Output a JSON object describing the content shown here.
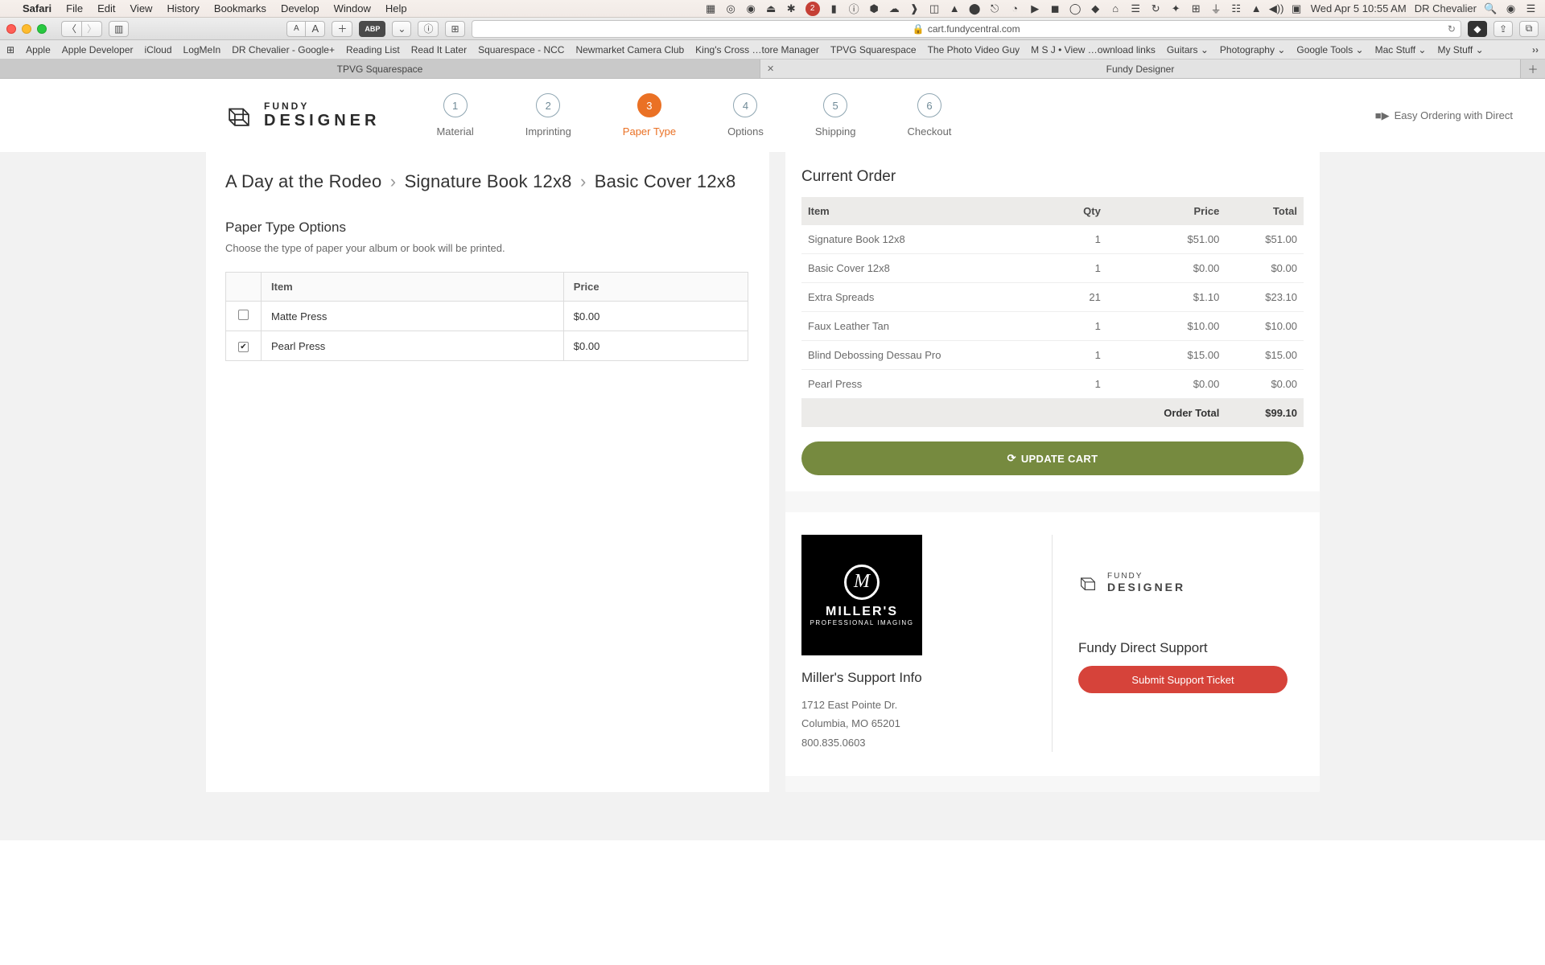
{
  "menubar": {
    "app": "Safari",
    "items": [
      "File",
      "Edit",
      "View",
      "History",
      "Bookmarks",
      "Develop",
      "Window",
      "Help"
    ],
    "clock": "Wed Apr 5  10:55 AM",
    "user": "DR Chevalier",
    "badge": "2"
  },
  "safari": {
    "url": "cart.fundycentral.com",
    "bookmarks": [
      "Apple",
      "Apple Developer",
      "iCloud",
      "LogMeIn",
      "DR Chevalier - Google+",
      "Reading List",
      "Read It Later",
      "Squarespace - NCC",
      "Newmarket Camera Club",
      "King's Cross …tore Manager",
      "TPVG Squarespace",
      "The Photo Video Guy",
      "M S J • View …ownload links",
      "Guitars",
      "Photography",
      "Google Tools",
      "Mac Stuff",
      "My Stuff"
    ],
    "tabs": [
      {
        "label": "TPVG Squarespace",
        "active": false
      },
      {
        "label": "Fundy Designer",
        "active": true
      }
    ]
  },
  "logo": {
    "line1": "FUNDY",
    "line2": "DESIGNER"
  },
  "steps": [
    {
      "n": "1",
      "label": "Material"
    },
    {
      "n": "2",
      "label": "Imprinting"
    },
    {
      "n": "3",
      "label": "Paper Type"
    },
    {
      "n": "4",
      "label": "Options"
    },
    {
      "n": "5",
      "label": "Shipping"
    },
    {
      "n": "6",
      "label": "Checkout"
    }
  ],
  "active_step": 2,
  "easy_ordering": "Easy Ordering with Direct",
  "breadcrumb": [
    "A Day at the Rodeo",
    "Signature Book 12x8",
    "Basic Cover 12x8"
  ],
  "section": {
    "title": "Paper Type Options",
    "desc": "Choose the type of paper your album or book will be printed."
  },
  "opt_headers": [
    "Item",
    "Price"
  ],
  "options": [
    {
      "selected": false,
      "item": "Matte Press",
      "price": "$0.00"
    },
    {
      "selected": true,
      "item": "Pearl Press",
      "price": "$0.00"
    }
  ],
  "order": {
    "title": "Current Order",
    "headers": [
      "Item",
      "Qty",
      "Price",
      "Total"
    ],
    "rows": [
      {
        "item": "Signature Book 12x8",
        "qty": "1",
        "price": "$51.00",
        "total": "$51.00"
      },
      {
        "item": "Basic Cover 12x8",
        "qty": "1",
        "price": "$0.00",
        "total": "$0.00"
      },
      {
        "item": "Extra Spreads",
        "qty": "21",
        "price": "$1.10",
        "total": "$23.10"
      },
      {
        "item": "Faux Leather Tan",
        "qty": "1",
        "price": "$10.00",
        "total": "$10.00"
      },
      {
        "item": "Blind Debossing Dessau Pro",
        "qty": "1",
        "price": "$15.00",
        "total": "$15.00"
      },
      {
        "item": "Pearl Press",
        "qty": "1",
        "price": "$0.00",
        "total": "$0.00"
      }
    ],
    "total_label": "Order Total",
    "total_value": "$99.10",
    "update_btn": "UPDATE CART"
  },
  "support": {
    "millers": {
      "t1": "MILLER'S",
      "t2": "PROFESSIONAL IMAGING"
    },
    "millers_title": "Miller's Support Info",
    "addr1": "1712 East Pointe Dr.",
    "addr2": "Columbia, MO 65201",
    "phone": "800.835.0603",
    "fundy_title": "Fundy Direct Support",
    "ticket_btn": "Submit Support Ticket"
  }
}
